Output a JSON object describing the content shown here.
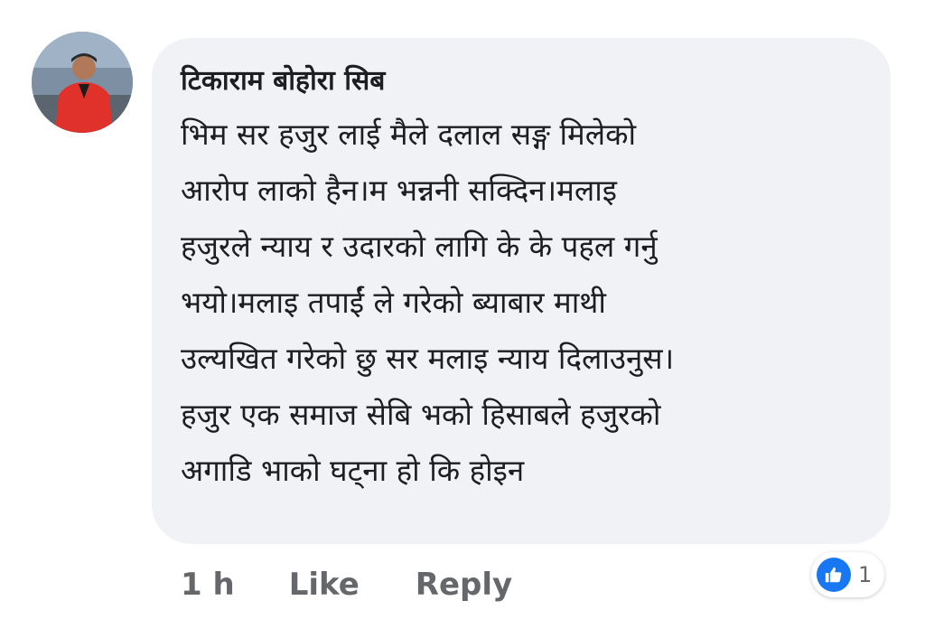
{
  "comment": {
    "author": "टिकाराम बोहोरा सिब",
    "lines": [
      "भिम सर हजुर लाई मैले दलाल सङ्ग मिलेको",
      "आरोप लाको हैन।म भन्ननी सक्दिन।मलाइ",
      "हजुरले न्याय र उदारको लागि के के पहल गर्नु",
      "भयो।मलाइ तपाईं ले गरेको ब्याबार माथी",
      "उल्यखित गरेको छु सर मलाइ न्याय दिलाउनुस।",
      "हजुर एक समाज सेबि भको हिसाबले हजुरको",
      "अगाडि भाको घट्ना हो कि होइन"
    ]
  },
  "actions": {
    "time": "1 h",
    "like_label": "Like",
    "reply_label": "Reply"
  },
  "reactions": {
    "icon": "like-icon",
    "count": "1",
    "color": "#1877f2"
  }
}
